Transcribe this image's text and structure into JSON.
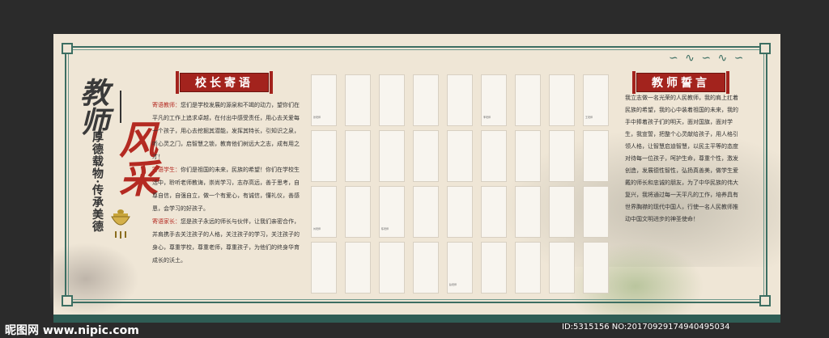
{
  "board": {
    "title_main_1": "教师",
    "title_main_2": "风采",
    "title_sub": "厚德载物·传承美德"
  },
  "principal": {
    "header": "校长寄语",
    "paragraphs": [
      {
        "label": "寄语教师：",
        "text": "您们是学校发展的源泉和不竭的动力，望你们在平凡的工作上追求卓越，在付出中感受责任，用心去关爱每一个孩子，用心去挖掘其潜能，发挥其特长，引知识之泉，听心灵之门，启智慧之锁，教育他们树远大之志，成有用之才！"
      },
      {
        "label": "寄语学生：",
        "text": "你们是祖国的未来，民族的希望！你们在学校生活中，聆听老师教诲，崇尚学习，志存高远，善于思考，自尊自信，自强自立，做一个有爱心，有诚信，懂礼仪，善感恩，会学习的好孩子。"
      },
      {
        "label": "寄语家长：",
        "text": "您是孩子永远的师长与伙伴，让我们亲密合作，并肩携手去关注孩子的人格，关注孩子的学习，关注孩子的身心，尊重学校，尊重老师，尊重孩子，为他们的终身华育成长的沃土。"
      }
    ]
  },
  "oath": {
    "header": "教师誓言",
    "text": "我立志做一名光荣的人民教师，我的肩上扛着民族的希望，我的心中装着祖国的未来，我的手中捧着孩子们的明天，面对国旗，面对学生，我宣誓，把整个心灵献给孩子，用人格引领人格，让智慧启迪智慧，以民主平等的态度对待每一位孩子，呵护生命，尊重个性，激发创造，发展德性智性，弘扬真善美，做学生爱戴的师长和忠诚的朋友，为了中华民族的伟大复兴，我将通过每一天平凡的工作，培养具有世界胸襟的现代中国人，行使一名人民教师推动中国文明进步的神圣使命！"
  },
  "teacher_cards": {
    "rows": 4,
    "cols": 9,
    "captions": [
      [
        "张老师",
        "",
        "",
        "",
        "",
        "李老师",
        "",
        "",
        "王老师"
      ],
      [
        "",
        "",
        "",
        "",
        "",
        "",
        "",
        "",
        ""
      ],
      [
        "刘老师",
        "",
        "陈老师",
        "",
        "",
        "",
        "",
        "",
        ""
      ],
      [
        "",
        "",
        "",
        "",
        "赵老师",
        "",
        "",
        "",
        ""
      ]
    ]
  },
  "watermark": {
    "site": "昵图网 www.nipic.com",
    "id_text": "ID:5315156 NO:20170929174940495034"
  },
  "colors": {
    "background": "#2b2b2b",
    "board": "#efe6d6",
    "frame": "#3c6e62",
    "accent_red": "#b42a22"
  }
}
